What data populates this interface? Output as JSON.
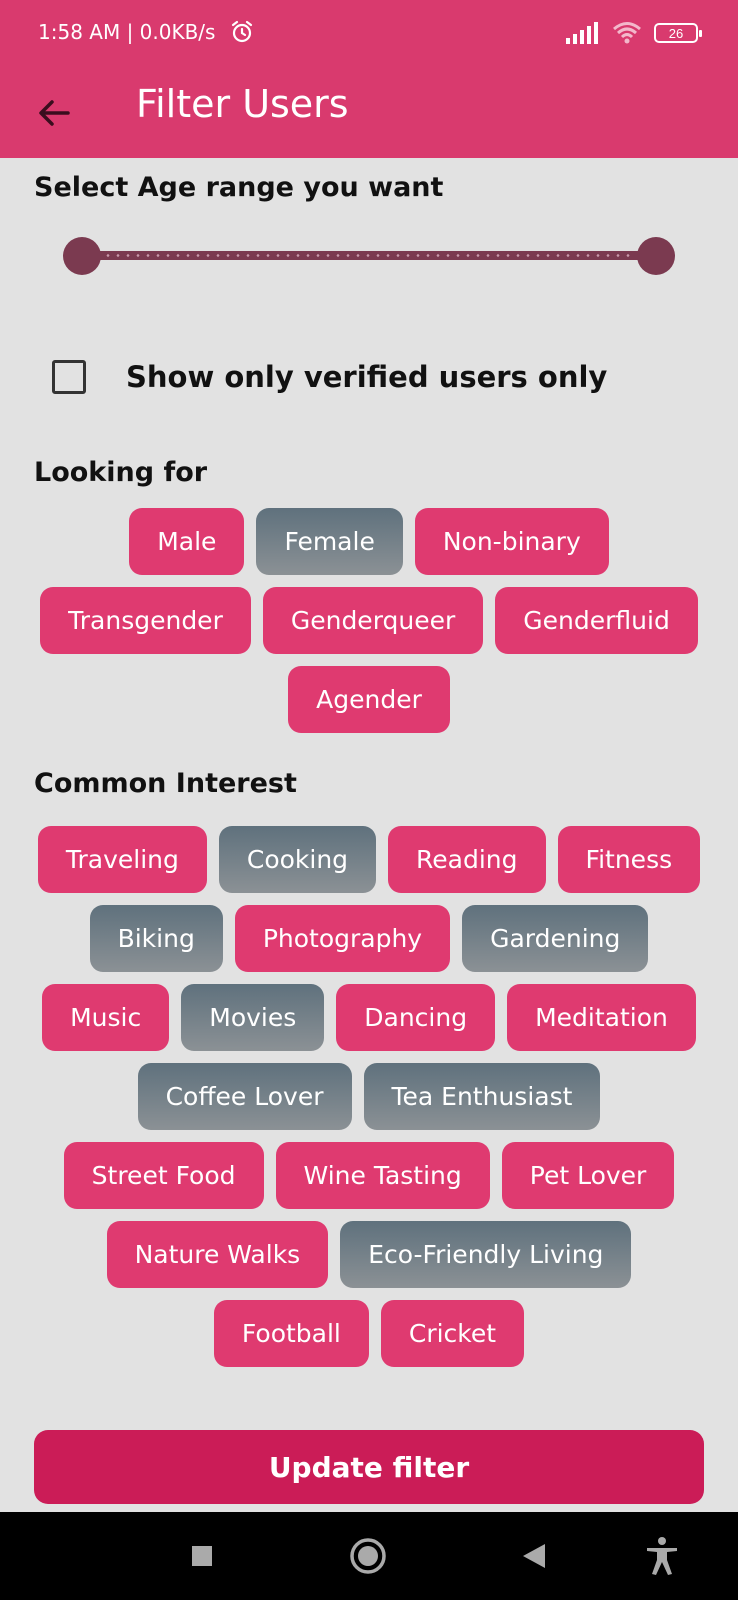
{
  "status_bar": {
    "time": "1:58 AM | 0.0KB/s",
    "alarm_icon": "alarm-icon",
    "battery": "26",
    "signal_icon": "signal-icon",
    "wifi_icon": "wifi-icon"
  },
  "app_bar": {
    "title": "Filter Users",
    "back_icon": "arrow-left-icon"
  },
  "age": {
    "title": "Select Age range you want",
    "range": [
      0,
      1
    ]
  },
  "verified": {
    "label": "Show only verified users only",
    "checked": false
  },
  "looking_for": {
    "title": "Looking for",
    "chips": [
      {
        "label": "Male",
        "selected": false
      },
      {
        "label": "Female",
        "selected": true
      },
      {
        "label": "Non-binary",
        "selected": false
      },
      {
        "label": "Transgender",
        "selected": false
      },
      {
        "label": "Genderqueer",
        "selected": false
      },
      {
        "label": "Genderfluid",
        "selected": false
      },
      {
        "label": "Agender",
        "selected": false
      }
    ]
  },
  "interests": {
    "title": "Common Interest",
    "chips": [
      {
        "label": "Traveling",
        "selected": false
      },
      {
        "label": "Cooking",
        "selected": true
      },
      {
        "label": "Reading",
        "selected": false
      },
      {
        "label": "Fitness",
        "selected": false
      },
      {
        "label": "Biking",
        "selected": true
      },
      {
        "label": "Photography",
        "selected": false
      },
      {
        "label": "Gardening",
        "selected": true
      },
      {
        "label": "Music",
        "selected": false
      },
      {
        "label": "Movies",
        "selected": true
      },
      {
        "label": "Dancing",
        "selected": false
      },
      {
        "label": "Meditation",
        "selected": false
      },
      {
        "label": "Coffee Lover",
        "selected": true
      },
      {
        "label": "Tea Enthusiast",
        "selected": true
      },
      {
        "label": "Street Food",
        "selected": false
      },
      {
        "label": "Wine Tasting",
        "selected": false
      },
      {
        "label": "Pet Lover",
        "selected": false
      },
      {
        "label": "Nature Walks",
        "selected": false
      },
      {
        "label": "Eco-Friendly Living",
        "selected": true
      },
      {
        "label": "Football",
        "selected": false
      },
      {
        "label": "Cricket",
        "selected": false
      }
    ]
  },
  "update_button": "Update filter",
  "colors": {
    "primary": "#d93a6e",
    "chip_unselected": "#df3a70",
    "chip_selected": "#5f717d",
    "button": "#cb1c57",
    "slider": "#7b3a50"
  },
  "nav": {
    "recents_icon": "square-icon",
    "home_icon": "circle-icon",
    "back_icon": "triangle-back-icon",
    "accessibility_icon": "accessibility-icon"
  }
}
